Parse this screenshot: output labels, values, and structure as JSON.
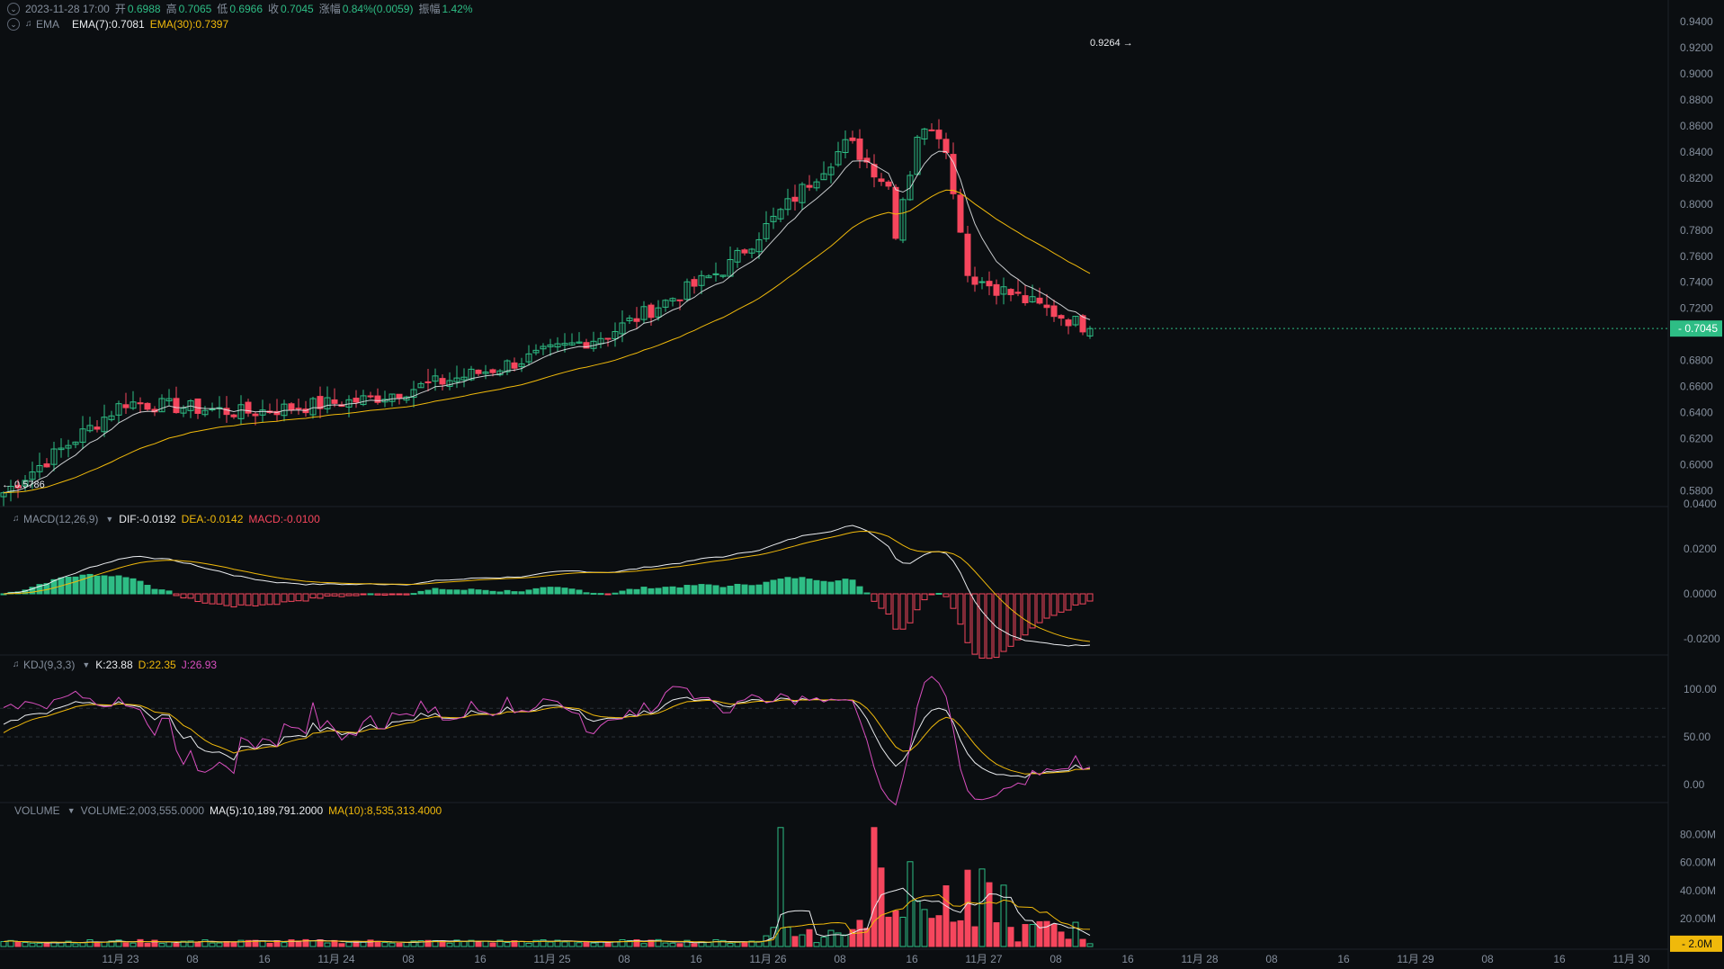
{
  "header": {
    "datetime": "2023-11-28 17:00",
    "open_label": "开",
    "open": "0.6988",
    "high_label": "高",
    "high": "0.7065",
    "low_label": "低",
    "low": "0.6966",
    "close_label": "收",
    "close": "0.7045",
    "change_label": "涨幅",
    "change": "0.84%(0.0059)",
    "amp_label": "振幅",
    "amp": "1.42%"
  },
  "ema_legend": {
    "name": "EMA",
    "ema7": "EMA(7):0.7081",
    "ema30": "EMA(30):0.7397"
  },
  "macd_legend": {
    "name": "MACD(12,26,9)",
    "dif": "DIF:-0.0192",
    "dea": "DEA:-0.0142",
    "macd": "MACD:-0.0100"
  },
  "kdj_legend": {
    "name": "KDJ(9,3,3)",
    "k": "K:23.88",
    "d": "D:22.35",
    "j": "J:26.93"
  },
  "volume_legend": {
    "name": "VOLUME",
    "volume": "VOLUME:2,003,555.0000",
    "ma5": "MA(5):10,189,791.2000",
    "ma10": "MA(10):8,535,313.4000"
  },
  "price_axis": [
    "0.9400",
    "0.9200",
    "0.9000",
    "0.8800",
    "0.8600",
    "0.8400",
    "0.8200",
    "0.8000",
    "0.7800",
    "0.7600",
    "0.7400",
    "0.7200",
    "0.6800",
    "0.6600",
    "0.6400",
    "0.6200",
    "0.6000",
    "0.5800"
  ],
  "macd_axis": [
    "0.0400",
    "0.0200",
    "0.0000",
    "-0.0200"
  ],
  "kdj_axis": [
    "100.00",
    "50.00",
    "0.00"
  ],
  "volume_axis": [
    "80.00M",
    "60.00M",
    "40.00M",
    "20.00M"
  ],
  "last_price_tag": "0.7045",
  "last_volume_tag": "2.0M",
  "max_marker": "0.9264 →",
  "min_marker": "← 0.5786",
  "time_axis": [
    "11月 23",
    "08",
    "16",
    "11月 24",
    "08",
    "16",
    "11月 25",
    "08",
    "16",
    "11月 26",
    "08",
    "16",
    "11月 27",
    "08",
    "16",
    "11月 28",
    "08",
    "16",
    "11月 29",
    "08",
    "16",
    "11月 30"
  ],
  "colors": {
    "up": "#2ebd85",
    "down": "#f6465d",
    "ema7": "#eaecef",
    "ema30": "#f0b90b",
    "j": "#d94fbf",
    "bg": "#0b0e11",
    "grid": "#1e2329"
  },
  "chart_data": {
    "type": "candlestick",
    "interval": "1h",
    "x": [
      "11月 23",
      "11月 24",
      "11月 25",
      "11月 26",
      "11月 27",
      "11月 28"
    ],
    "price_range": [
      0.57,
      0.94
    ],
    "max_high": 0.9264,
    "min_low": 0.5786,
    "last_ohlc": {
      "open": 0.6988,
      "high": 0.7065,
      "low": 0.6966,
      "close": 0.7045
    },
    "daily_closes_approx": [
      0.5786,
      0.648,
      0.64,
      0.65,
      0.672,
      0.7,
      0.752,
      0.848,
      0.745,
      0.7045
    ],
    "indicators": {
      "ema7": 0.7081,
      "ema30": 0.7397,
      "macd": {
        "dif": -0.0192,
        "dea": -0.0142,
        "macd": -0.01
      },
      "kdj": {
        "k": 23.88,
        "d": 22.35,
        "j": 26.93
      },
      "volume": {
        "last": 2003555.0,
        "ma5": 10189791.2,
        "ma10": 8535313.4
      }
    },
    "volume_range": [
      0,
      90000000
    ]
  }
}
